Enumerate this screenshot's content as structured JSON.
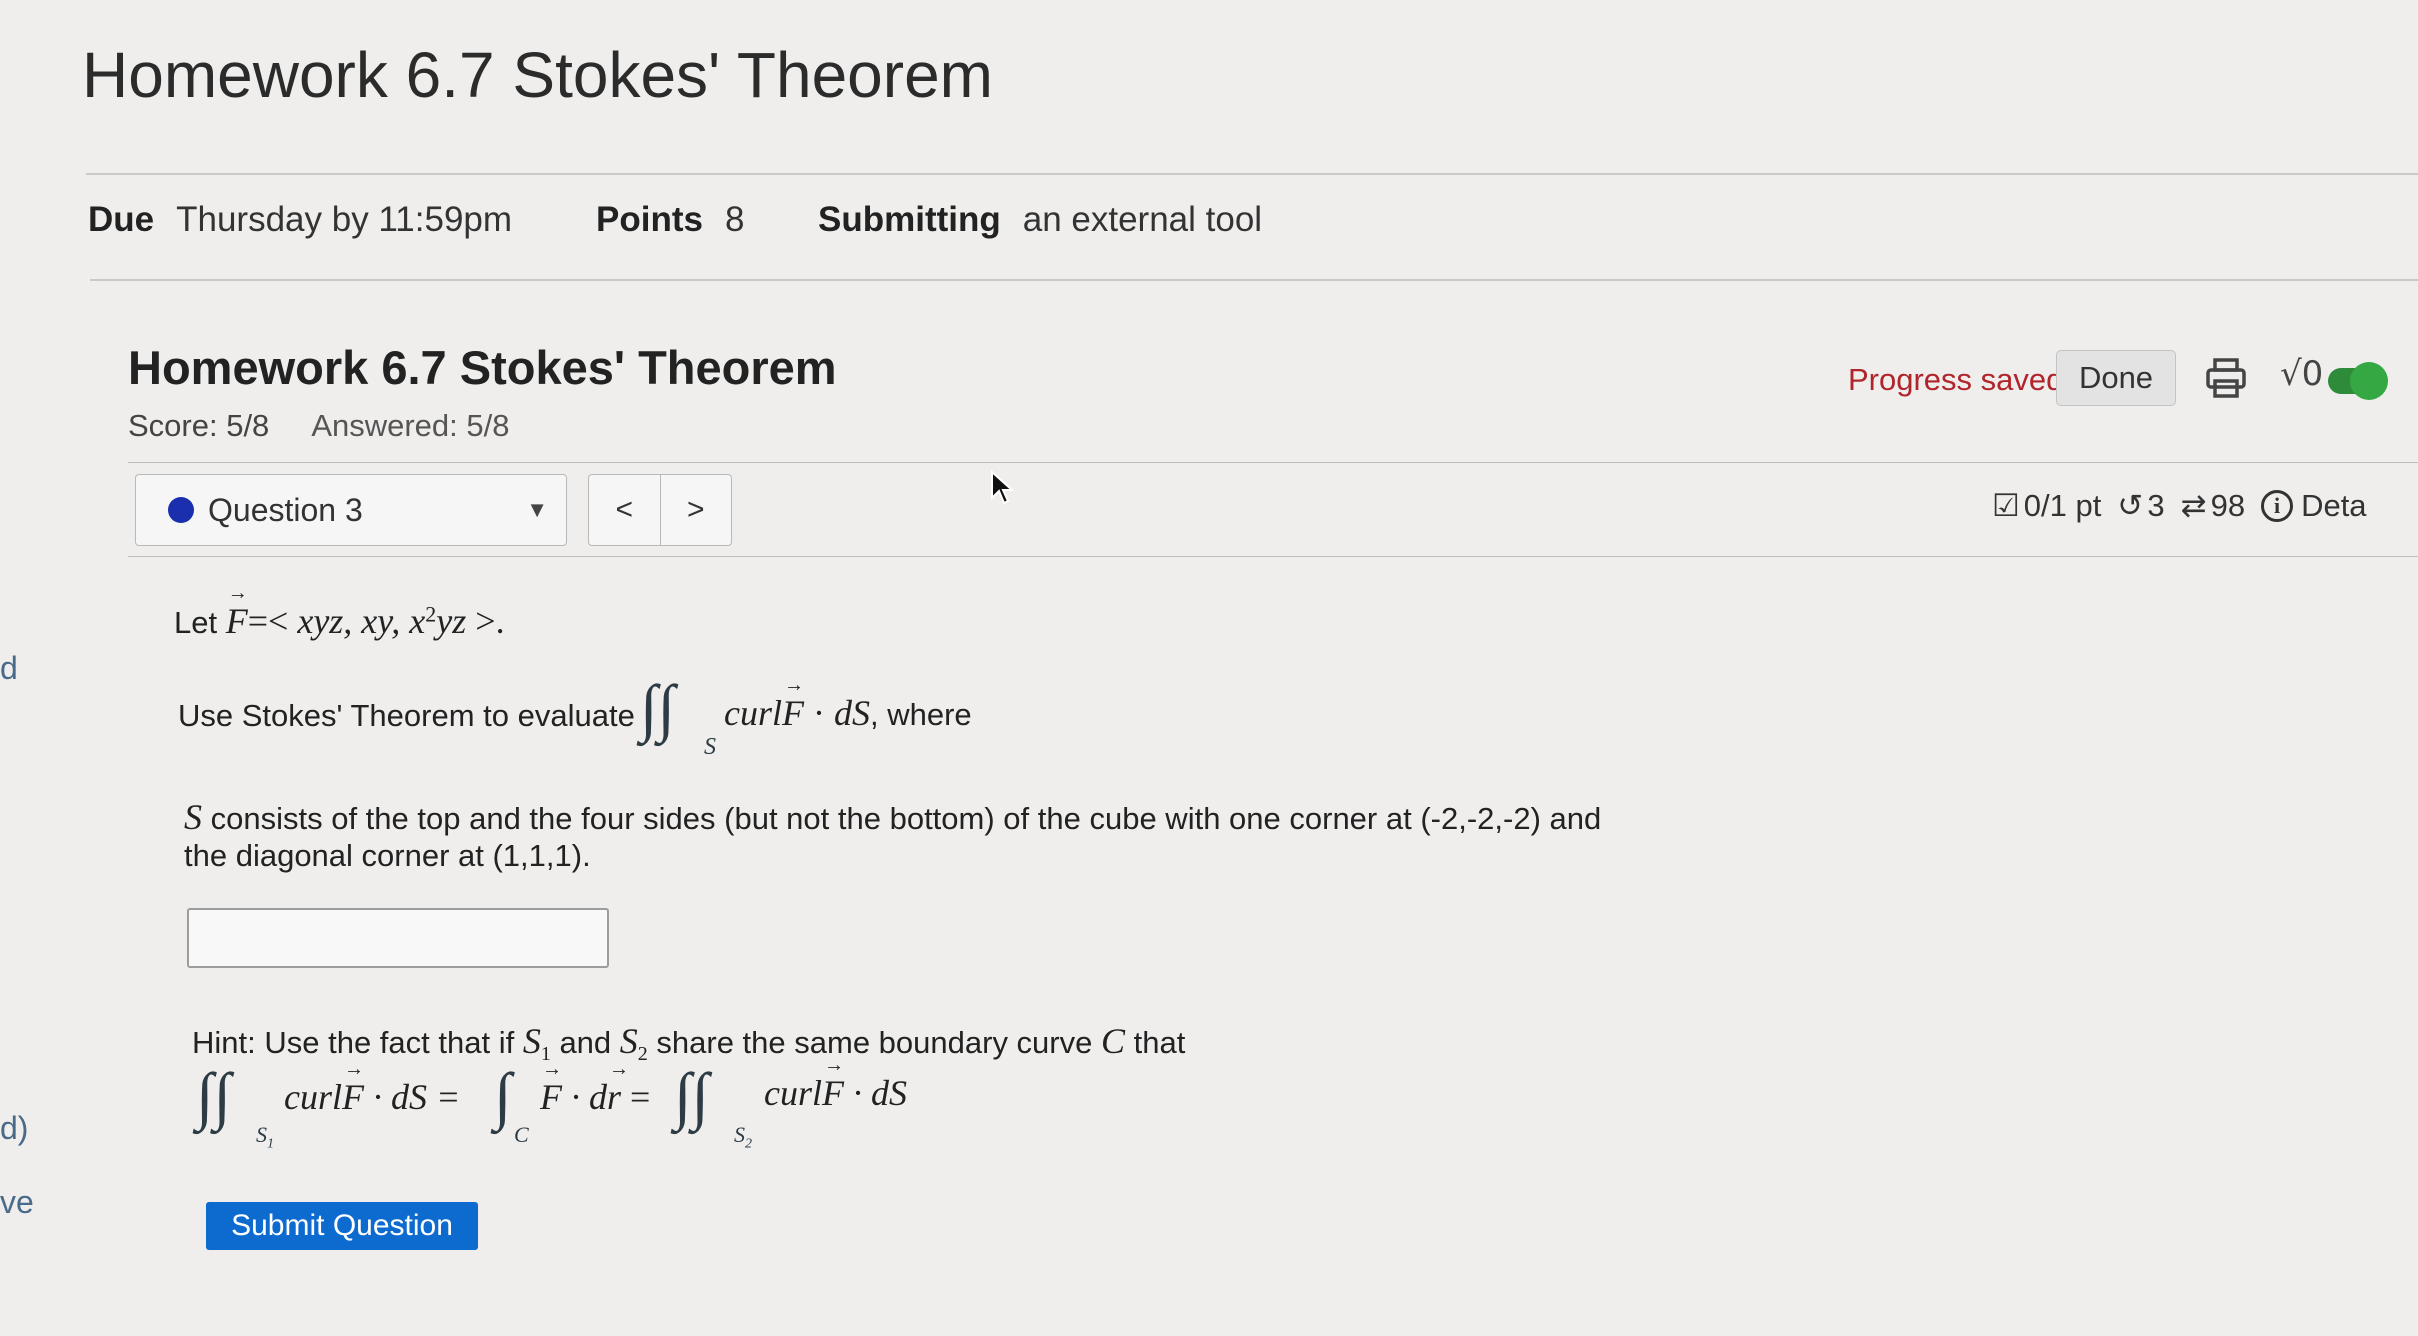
{
  "page": {
    "title": "Homework 6.7 Stokes' Theorem"
  },
  "meta": {
    "due_label": "Due",
    "due_value": "Thursday by 11:59pm",
    "points_label": "Points",
    "points_value": "8",
    "submitting_label": "Submitting",
    "submitting_value": "an external tool"
  },
  "left_fragments": [
    "d",
    "d)",
    "ve"
  ],
  "assignment": {
    "title": "Homework 6.7 Stokes' Theorem",
    "score": "Score: 5/8",
    "answered": "Answered: 5/8"
  },
  "toolbar": {
    "progress_saved": "Progress saved",
    "done_label": "Done",
    "print_icon": "printer-icon",
    "sqrt_label": "√0",
    "toggle_on": true,
    "toggle_color": "#35a843"
  },
  "question_nav": {
    "selected": "Question 3",
    "prev_label": "<",
    "next_label": ">"
  },
  "stats": {
    "points": "0/1 pt",
    "retries": "3",
    "versions": "98",
    "details": "Deta"
  },
  "problem": {
    "let_text": "Let",
    "field_prefix": "=< ",
    "field_expr": "xyz, xy, x",
    "field_sup": "2",
    "field_tail": "yz",
    "field_suffix": " >.",
    "use_text": "Use Stokes' Theorem to evaluate",
    "integrand_curl": "curl",
    "integrand_dot": " · ",
    "integrand_dS": "dS",
    "where_text": ", where",
    "S_sym": "S",
    "surface_desc_line1": " consists of the top and the four sides (but not the bottom) of the cube with one corner at (-2,-2,-2) and",
    "surface_desc_line2": "the diagonal corner at (1,1,1).",
    "answer_value": "",
    "hint_label": "Hint:",
    "hint_text1": " Use the fact that if ",
    "hint_S1": "S",
    "hint_sub1": "1",
    "hint_and": " and ",
    "hint_S2": "S",
    "hint_sub2": "2",
    "hint_text2": " share the same boundary curve ",
    "hint_C": "C",
    "hint_that": " that",
    "eq_curl1": "curl",
    "eq_dS1": " · dS =",
    "eq_C_sub": "C",
    "eq_dr": " · d",
    "eq_r": "r",
    "eq_equals": " =",
    "eq_curl2": "curl",
    "eq_dS2": " · dS",
    "F_sym": "F"
  },
  "submit": {
    "label": "Submit Question",
    "color": "#0d6bcf"
  }
}
